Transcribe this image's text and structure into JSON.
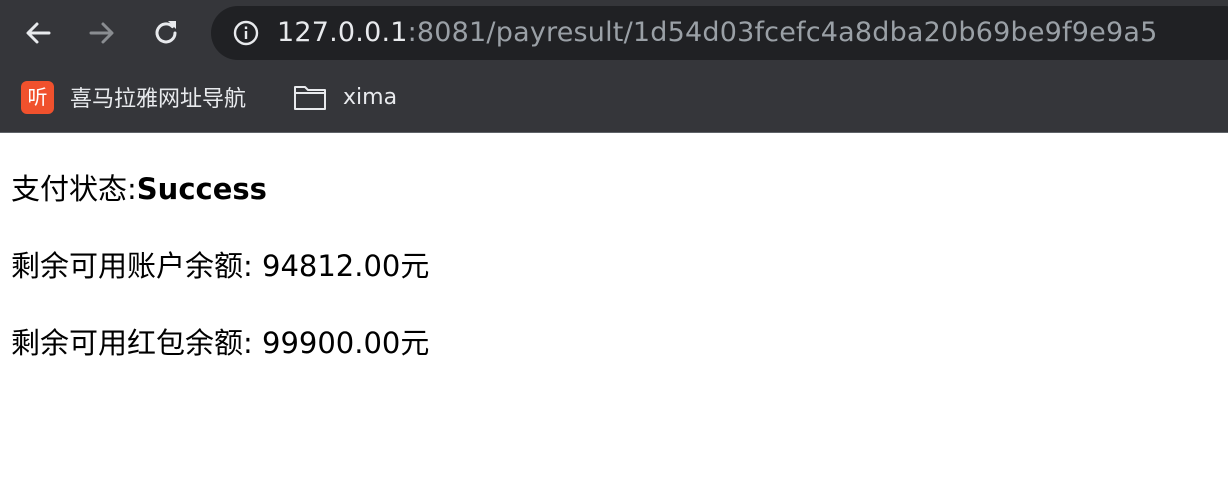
{
  "browser": {
    "url_host": "127.0.0.1",
    "url_rest": ":8081/payresult/1d54d03fcefc4a8dba20b69be9f9e9a5",
    "nav_icons": [
      "back-arrow-icon",
      "forward-arrow-icon",
      "reload-icon",
      "site-info-icon"
    ],
    "bookmarks": [
      {
        "label": "喜马拉雅网址导航",
        "icon": "ximalaya-favicon",
        "icon_glyph": "听"
      },
      {
        "label": "xima",
        "icon": "folder-icon"
      }
    ],
    "colors": {
      "toolbar_bg": "#35363a",
      "omnibox_bg": "#202124",
      "url_host": "#e8eaed",
      "url_rest": "#9aa0a6",
      "favicon_bg": "#f0512d"
    }
  },
  "page": {
    "status_label": "支付状态:",
    "status_value": "Success",
    "account_balance_line": "剩余可用账户余额: 94812.00元",
    "red_packet_balance_line": "剩余可用红包余额: 99900.00元"
  }
}
